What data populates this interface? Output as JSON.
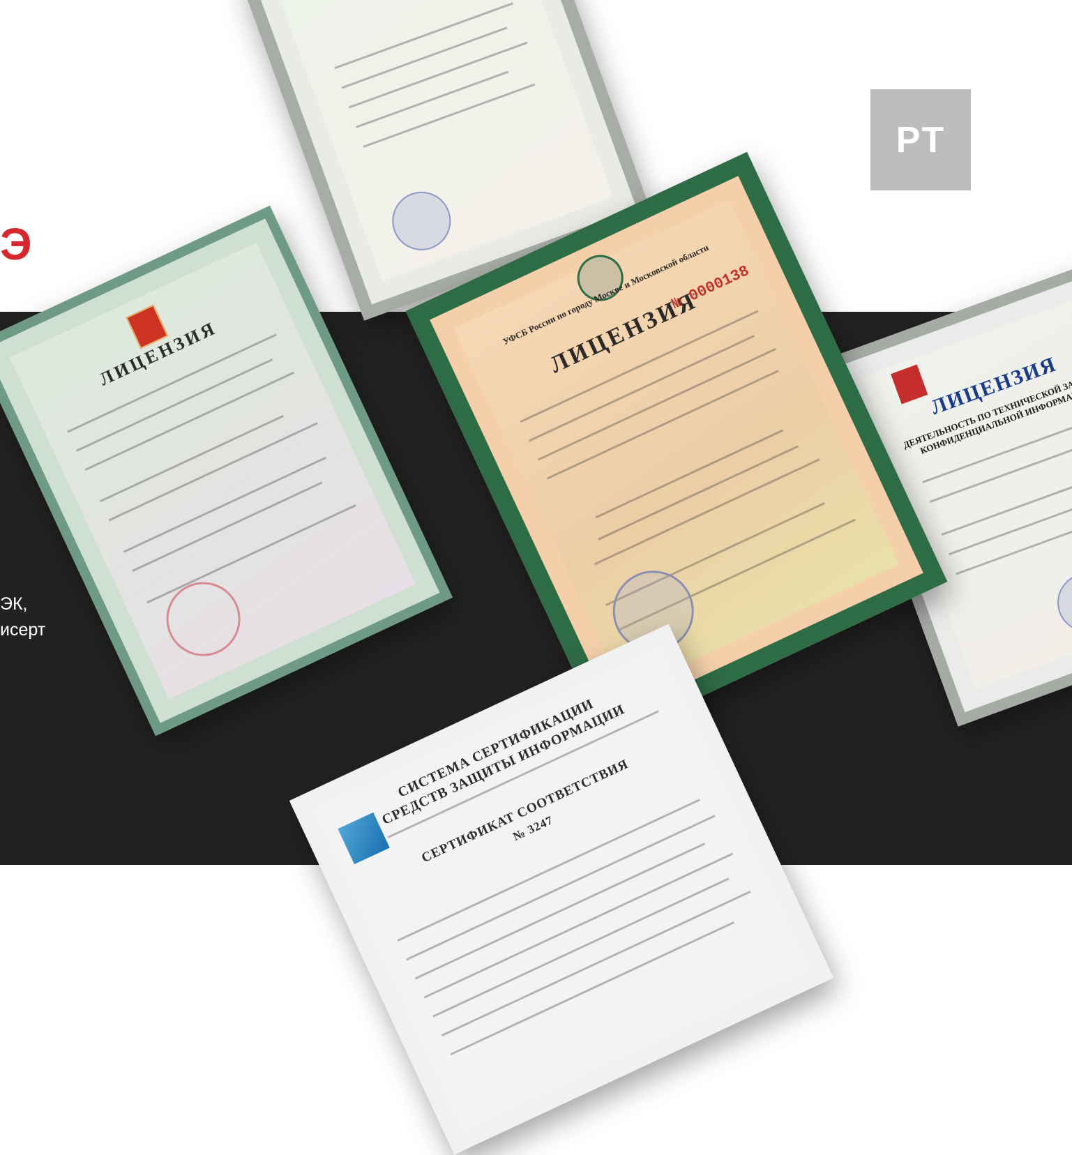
{
  "brand": {
    "logo_text": "PT",
    "partial_red_glyph": "Э",
    "accent_color": "#d8282f",
    "dark_band_color": "#222222",
    "logo_bg_color": "#bdbdbd"
  },
  "side_text": {
    "line1": "ЭК,",
    "line2": "исерт"
  },
  "documents": {
    "top": {
      "seal_icon": "stamp-seal-icon"
    },
    "left_license": {
      "title": "ЛИЦЕНЗИЯ",
      "emblem_icon": "coat-of-arms-icon",
      "seal_icon": "stamp-seal-icon"
    },
    "center_license": {
      "header": "УФСБ России по городу Москве и Московской области",
      "title": "ЛИЦЕНЗИЯ",
      "number": "№ 0000138",
      "emblem_icon": "coat-of-arms-icon",
      "seal_icon": "stamp-seal-icon"
    },
    "right_license": {
      "title": "ЛИЦЕНЗИЯ",
      "subtitle": "ДЕЯТЕЛЬНОСТЬ ПО ТЕХНИЧЕСКОЙ ЗАЩИТЕ КОНФИДЕНЦИАЛЬНОЙ ИНФОРМАЦИИ",
      "emblem_icon": "coat-of-arms-icon",
      "seal_icon": "stamp-seal-icon"
    },
    "certificate": {
      "line1": "СИСТЕМА СЕРТИФИКАЦИИ",
      "line2": "СРЕДСТВ ЗАЩИТЫ ИНФОРМАЦИИ",
      "line3": "СЕРТИФИКАТ СООТВЕТСТВИЯ",
      "line4": "№ 3247",
      "badge_icon": "certification-badge-icon"
    }
  }
}
